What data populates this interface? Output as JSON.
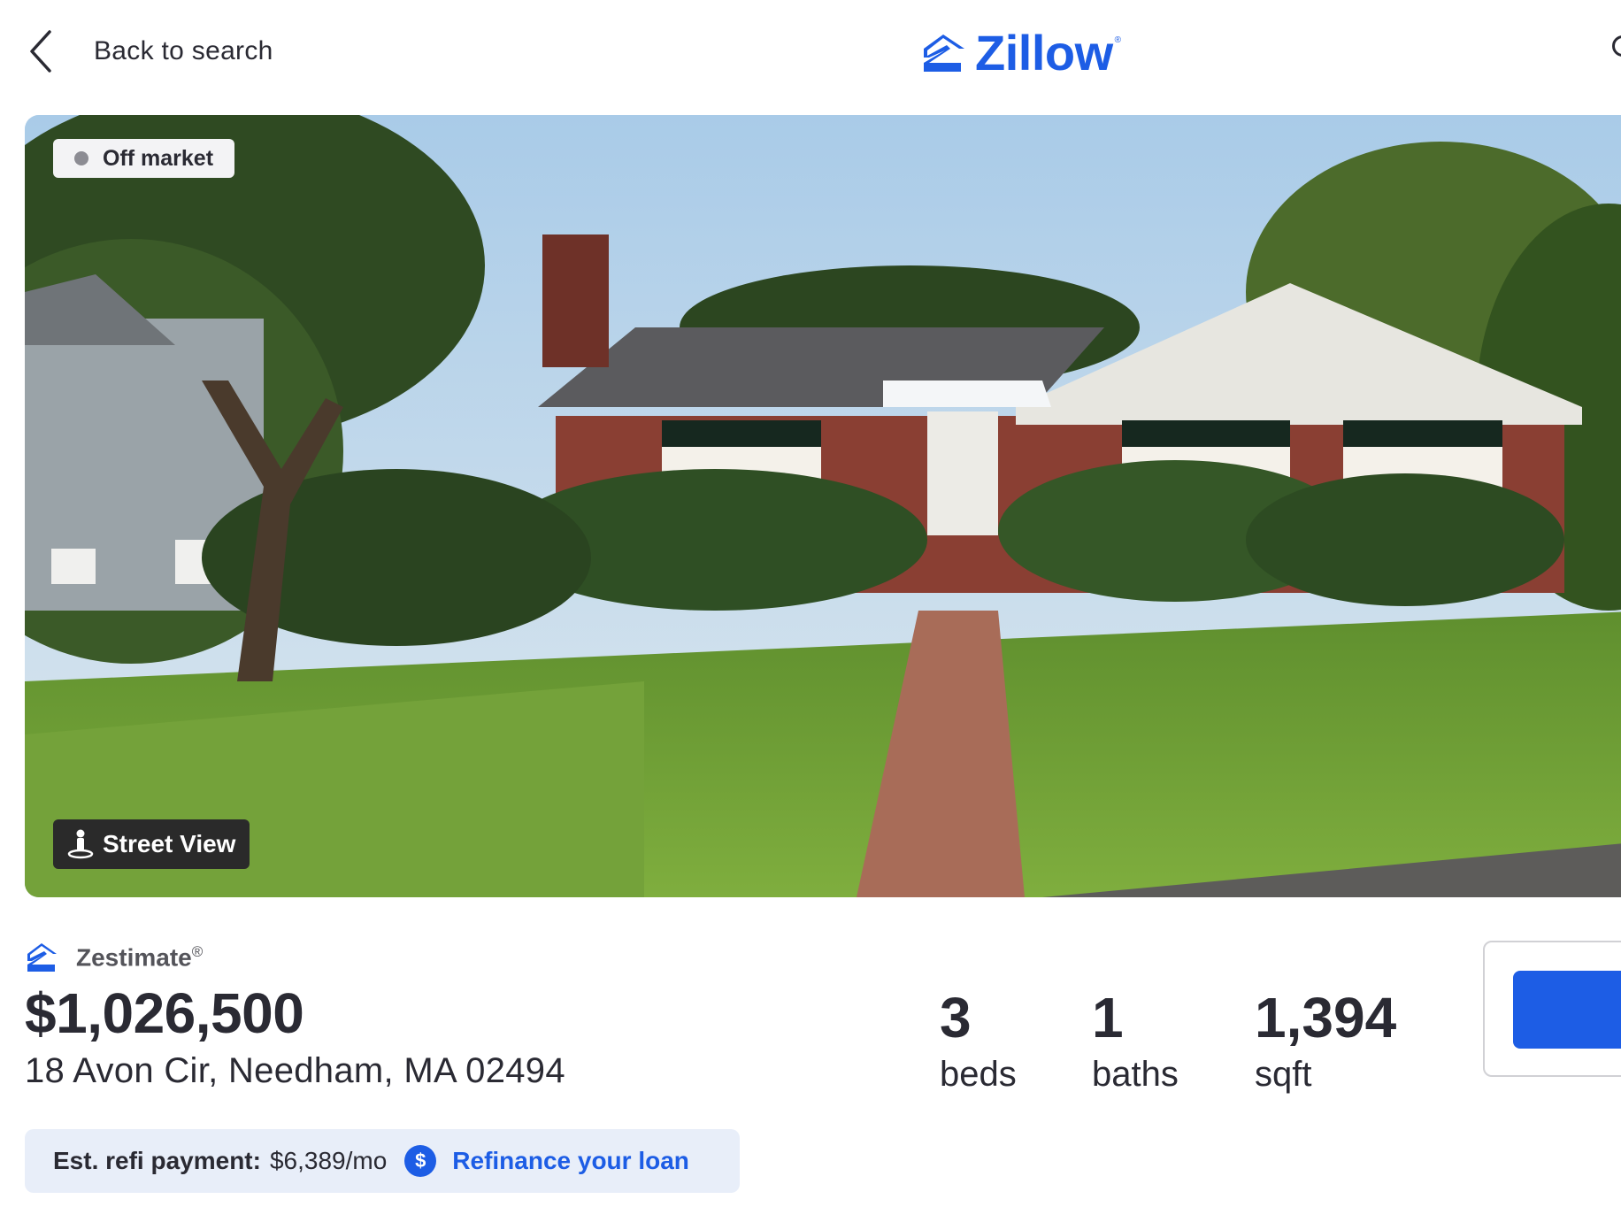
{
  "header": {
    "back_label": "Back to search",
    "logo_text": "Zillow",
    "logo_reg": "®",
    "icons": [
      "chevron-left-icon",
      "zillow-logo-icon",
      "search-icon"
    ]
  },
  "hero": {
    "status_badge": "Off market",
    "street_view_label": "Street View",
    "image_alt": "Brick ranch-style house with lawn and walkway"
  },
  "listing": {
    "zestimate_label": "Zestimate",
    "zestimate_reg": "®",
    "price": "$1,026,500",
    "address": "18 Avon Cir, Needham, MA 02494",
    "stats": [
      {
        "value": "3",
        "label": "beds"
      },
      {
        "value": "1",
        "label": "baths"
      },
      {
        "value": "1,394",
        "label": "sqft"
      }
    ]
  },
  "refi": {
    "label": "Est. refi payment:",
    "value": "$6,389/mo",
    "icon_text": "$",
    "link": "Refinance your loan"
  },
  "colors": {
    "brand": "#1d5de5",
    "text": "#2a2a33",
    "refi_bg": "#e8eef9"
  }
}
